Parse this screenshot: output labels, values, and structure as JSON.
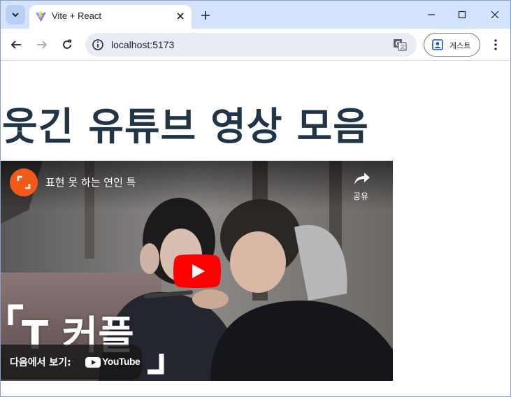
{
  "browser": {
    "tab_title": "Vite + React",
    "url": "localhost:5173",
    "profile_label": "게스트"
  },
  "page": {
    "heading": "웃긴 유튜브 영상 모음"
  },
  "video": {
    "title": "표현 못 하는 연인 특",
    "share_label": "공유",
    "watch_on_label": "다음에서 보기:",
    "youtube_logo_text": "YouTube",
    "thumbnail_text": "T 커플"
  },
  "colors": {
    "tab_strip": "#d3e3fd",
    "heading": "#213547",
    "channel_avatar": "#f25a1a",
    "play_button": "#ff0000"
  },
  "icons": {
    "tab_search": "chevron-down-icon",
    "favicon": "vite-logo-icon",
    "tab_close": "close-icon",
    "new_tab": "plus-icon",
    "minimize": "minimize-icon",
    "maximize": "maximize-icon",
    "close_window": "close-icon",
    "back": "arrow-left-icon",
    "forward": "arrow-right-icon",
    "reload": "reload-icon",
    "site_info": "info-icon",
    "translate": "translate-icon",
    "profile": "person-icon",
    "menu": "kebab-menu-icon",
    "share": "share-arrow-icon",
    "play": "play-icon"
  }
}
